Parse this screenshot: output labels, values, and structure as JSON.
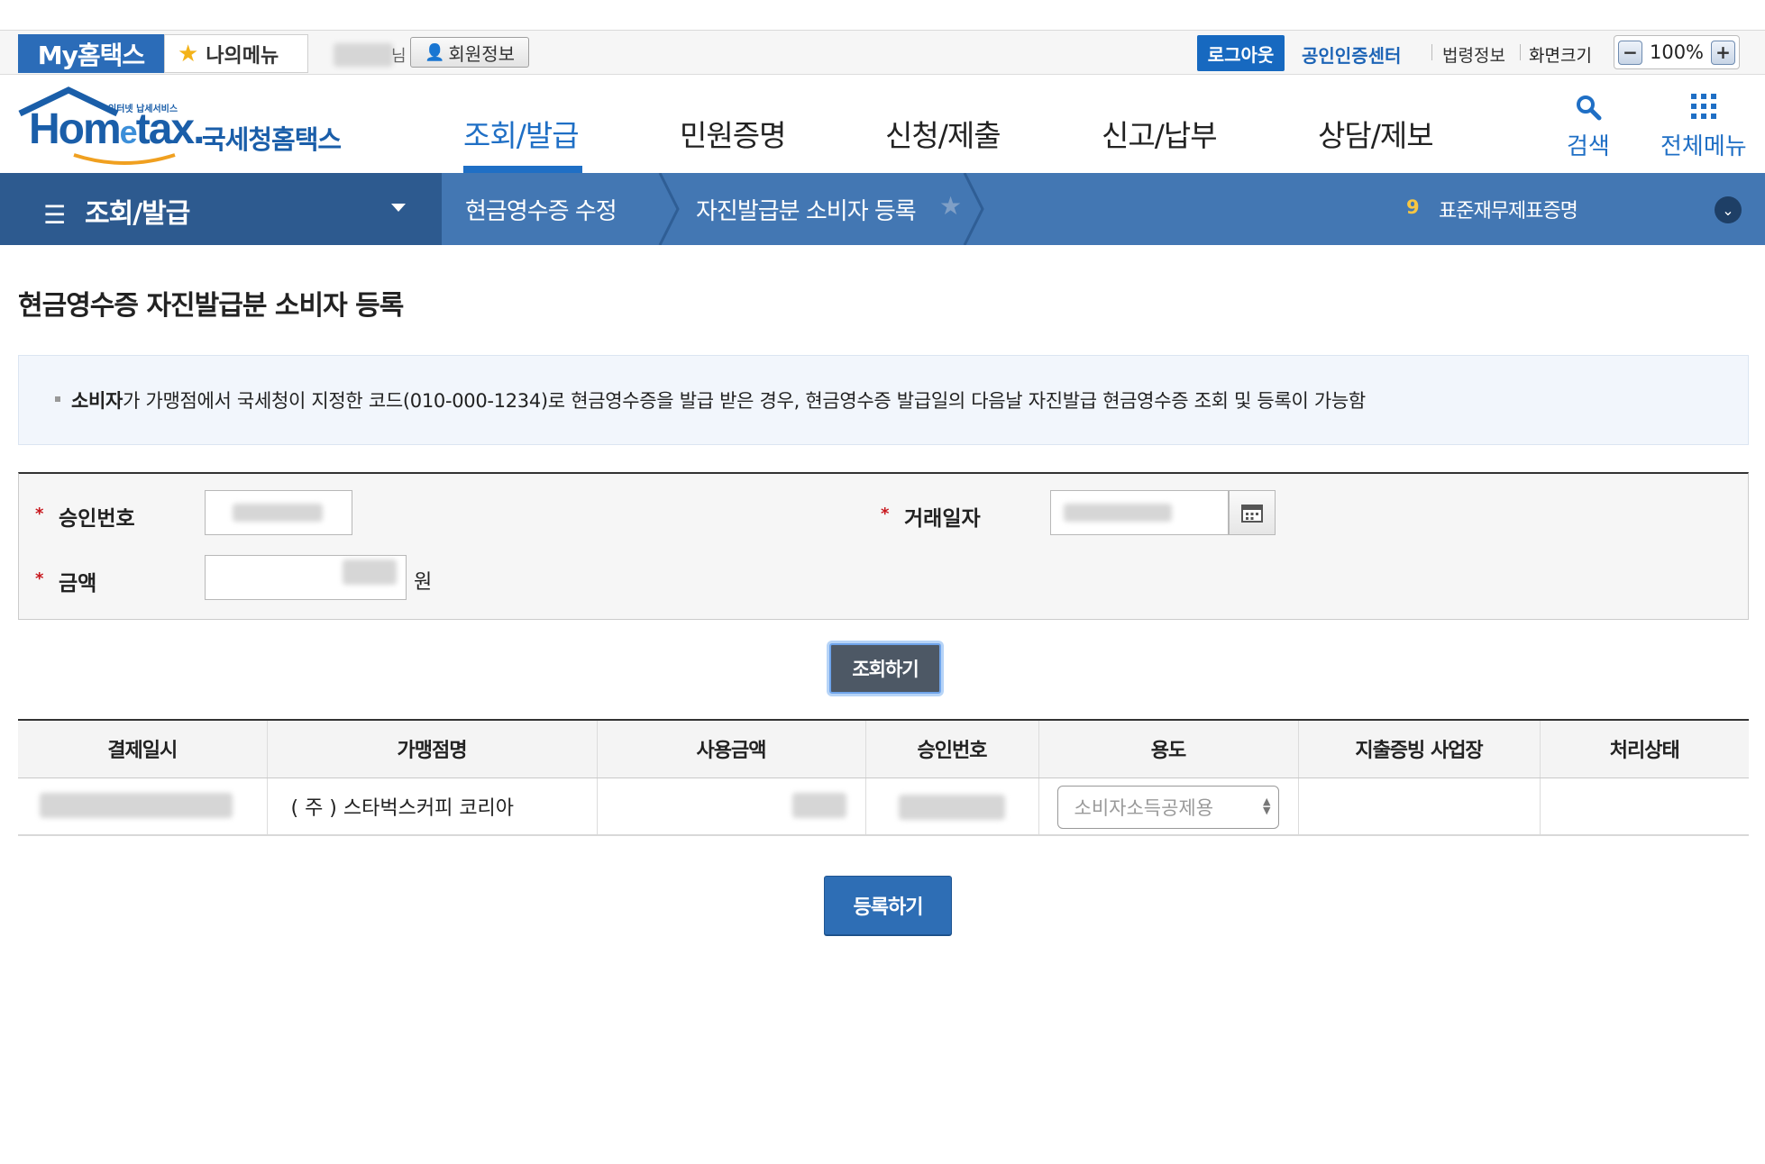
{
  "topbar": {
    "my_hometax": "My홈택스",
    "my_menu": "나의메뉴",
    "user_suffix": "님",
    "member_info": "회원정보",
    "logout": "로그아웃",
    "cert_center": "공인인증센터",
    "law_info": "법령정보",
    "screen_size": "화면크기",
    "zoom_minus": "−",
    "zoom_value": "100%",
    "zoom_plus": "+"
  },
  "logo": {
    "brand_pre": "Hom",
    "brand_e": "e",
    "brand_post": "tax.",
    "small_text": "인터넷 납세서비스",
    "korean_name": "국세청홈택스"
  },
  "main_nav": {
    "items": [
      "조회/발급",
      "민원증명",
      "신청/제출",
      "신고/납부",
      "상담/제보"
    ],
    "active_index": 0,
    "search_label": "검색",
    "all_menu_label": "전체메뉴"
  },
  "breadcrumb": {
    "section": "조회/발급",
    "items": [
      "현금영수증 수정",
      "자진발급분 소비자 등록"
    ],
    "quick_num": "9",
    "quick_text": "표준재무제표증명"
  },
  "page": {
    "title": "현금영수증 자진발급분 소비자 등록",
    "notice_bold": "소비자",
    "notice_rest": "가 가맹점에서 국세청이 지정한 코드(010-000-1234)로 현금영수증을 발급 받은 경우, 현금영수증 발급일의 다음날 자진발급 현금영수증 조회 및 등록이 가능함"
  },
  "form": {
    "approval_label": "승인번호",
    "date_label": "거래일자",
    "amount_label": "금액",
    "amount_unit": "원",
    "required_mark": "*",
    "search_button": "조회하기"
  },
  "table": {
    "headers": [
      "결제일시",
      "가맹점명",
      "사용금액",
      "승인번호",
      "용도",
      "지출증빙 사업장",
      "처리상태"
    ],
    "rows": [
      {
        "merchant": "( 주 ) 스타벅스커피 코리아",
        "usage": "소비자소득공제용"
      }
    ]
  },
  "register_button": "등록하기",
  "colors": {
    "brand_blue": "#1f6fc5",
    "breadcrumb_bar": "#4377b3",
    "breadcrumb_home": "#2d5a8f",
    "required_red": "#c8181e",
    "register_button": "#2e6eb5",
    "search_button": "#4d5865"
  }
}
